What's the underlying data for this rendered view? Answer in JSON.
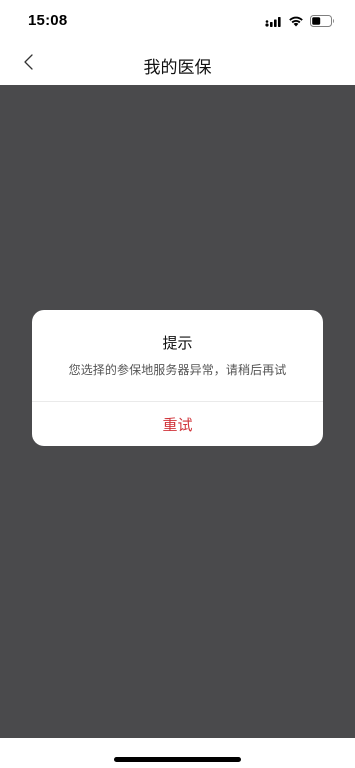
{
  "status_bar": {
    "time": "15:08",
    "icons": [
      "cellular-signal-icon",
      "wifi-icon",
      "battery-icon"
    ]
  },
  "nav": {
    "title": "我的医保",
    "back_icon": "chevron-left-icon"
  },
  "dialog": {
    "title": "提示",
    "message": "您选择的参保地服务器异常，请稍后再试",
    "button_label": "重试"
  },
  "colors": {
    "overlay": "#4a4a4c",
    "accent": "#d0343a",
    "background": "#ffffff"
  }
}
